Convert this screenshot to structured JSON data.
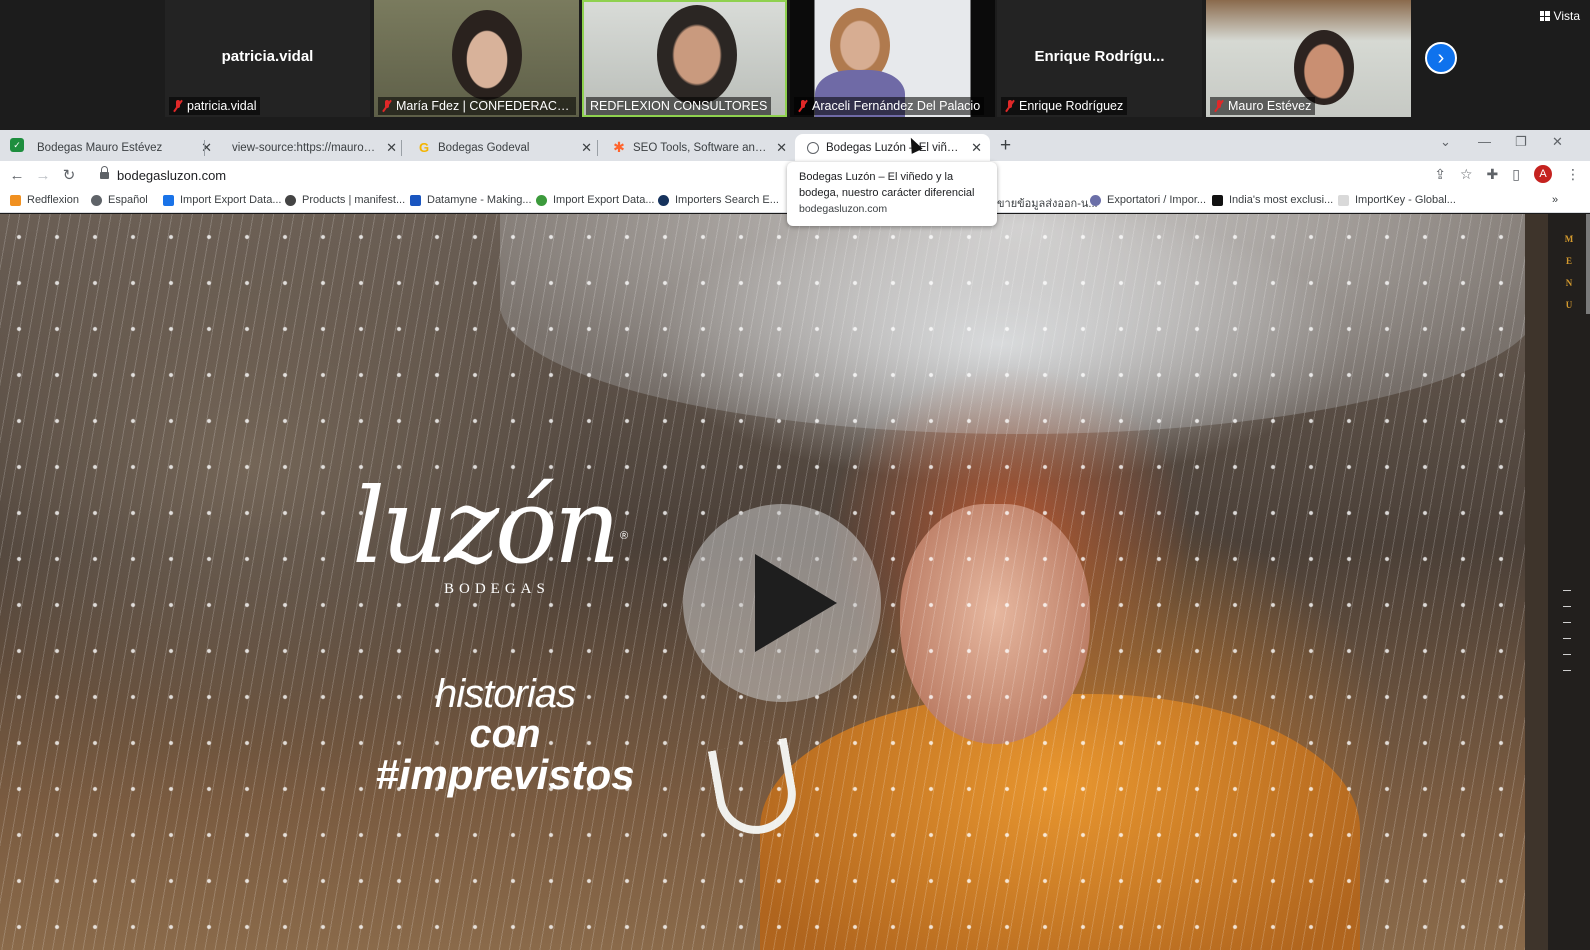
{
  "meeting": {
    "participants": [
      {
        "name": "patricia.vidal",
        "label": "patricia.vidal"
      },
      {
        "name": "María Fdez | CONFEDERACIO...",
        "label": "María Fdez | CONFEDERACIO..."
      },
      {
        "name": "REDFLEXION CONSULTORES",
        "label": "REDFLEXION CONSULTORES"
      },
      {
        "name": "Araceli Fernández Del Palacio",
        "label": "Araceli Fernández Del Palacio"
      },
      {
        "name": "Enrique  Rodrígu...",
        "label": "Enrique Rodríguez"
      },
      {
        "name": "Mauro Estévez",
        "label": "Mauro Estévez"
      }
    ],
    "view_label": "Vista",
    "next_icon": "chevron-right-icon"
  },
  "browser": {
    "tabs": [
      {
        "title": "Bodegas Mauro Estévez"
      },
      {
        "title": "view-source:https://mauroesteve..."
      },
      {
        "title": "Bodegas Godeval"
      },
      {
        "title": "SEO Tools, Software and Articles"
      },
      {
        "title": "Bodegas Luzón – El viñedo y la b..."
      }
    ],
    "url": "bodegasluzon.com",
    "bookmarks": [
      "Redflexion",
      "Español",
      "Import Export Data...",
      "Products | manifest...",
      "Datamyne - Making...",
      "Import Export Data...",
      "Importers Search E...",
      "ขายข้อมูลส่งออก-น...",
      "Exportatori / Impor...",
      "India's most exclusi...",
      "ImportKey - Global..."
    ],
    "tooltip": {
      "title": "Bodegas Luzón – El viñedo y la bodega, nuestro carácter diferencial",
      "url": "bodegasluzon.com"
    },
    "avatar_letter": "A"
  },
  "site": {
    "logo_word": "luzón",
    "logo_sub": "BODEGAS",
    "logo_reg": "®",
    "tagline_1": "historias",
    "tagline_2": "con",
    "tagline_3": "#imprevistos",
    "menu_letters": [
      "M",
      "E",
      "N",
      "U"
    ],
    "colors": {
      "menu_accent": "#d49a2e",
      "speaking_border": "#8fd14f",
      "zoom_blue": "#0e72ed"
    }
  }
}
